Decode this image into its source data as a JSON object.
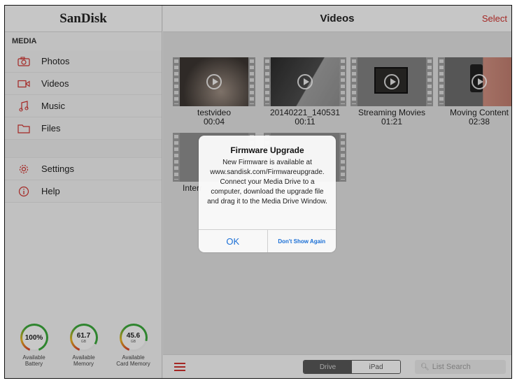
{
  "sidebar": {
    "logo": "SanDisk",
    "section_header": "MEDIA",
    "items": [
      {
        "label": "Photos",
        "icon": "camera-icon"
      },
      {
        "label": "Videos",
        "icon": "video-camera-icon"
      },
      {
        "label": "Music",
        "icon": "music-note-icon"
      },
      {
        "label": "Files",
        "icon": "folder-icon"
      },
      {
        "label": "Settings",
        "icon": "gear-icon"
      },
      {
        "label": "Help",
        "icon": "info-icon"
      }
    ],
    "gauges": [
      {
        "value": "100%",
        "unit": "",
        "label_line1": "Available",
        "label_line2": "Battery",
        "level": 1.0
      },
      {
        "value": "61.7",
        "unit": "GB",
        "label_line1": "Available",
        "label_line2": "Memory",
        "level": 0.8
      },
      {
        "value": "45.6",
        "unit": "GB",
        "label_line1": "Available",
        "label_line2": "Card Memory",
        "level": 0.75
      }
    ]
  },
  "header": {
    "title": "Videos",
    "select_label": "Select"
  },
  "videos": [
    {
      "name": "testvideo",
      "duration": "00:04"
    },
    {
      "name": "20140221_140531",
      "duration": "00:11"
    },
    {
      "name": "Streaming Movies",
      "duration": "01:21"
    },
    {
      "name": "Moving Content",
      "duration": "02:38"
    },
    {
      "name": "Interr",
      "duration": ""
    },
    {
      "name": "",
      "duration": ""
    }
  ],
  "bottombar": {
    "segment_drive": "Drive",
    "segment_ipad": "iPad",
    "search_placeholder": "List Search"
  },
  "dialog": {
    "title": "Firmware Upgrade",
    "message": "New Firmware is available at www.sandisk.com/Firmwareupgrade. Connect your Media Drive to a computer, download the upgrade file and drag it to the Media Drive Window.",
    "ok_label": "OK",
    "dont_show_label": "Don't Show Again"
  },
  "colors": {
    "accent_red": "#c9302c",
    "link_blue": "#1a6fd6",
    "gauge_green": "#3aa33a",
    "gauge_yellow": "#e0b020",
    "gauge_red": "#d23a2a"
  }
}
